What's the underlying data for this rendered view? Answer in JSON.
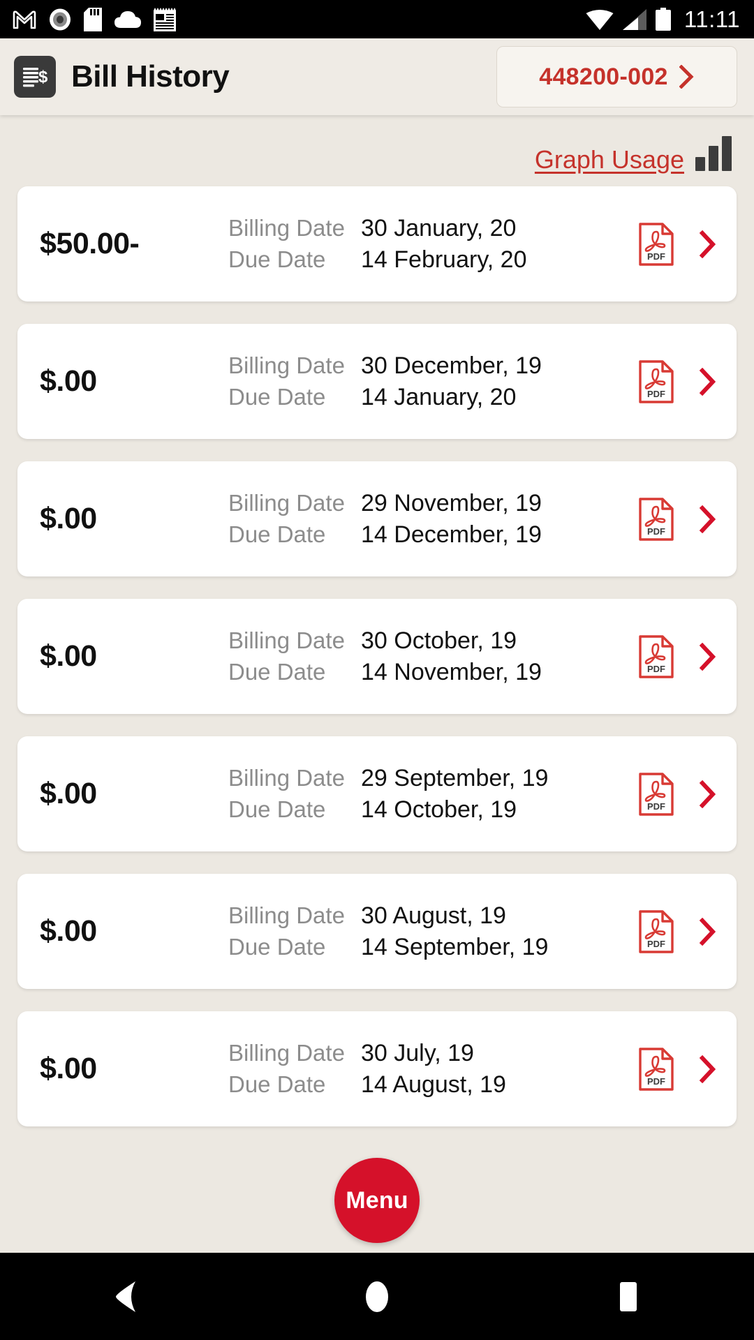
{
  "status_bar": {
    "time": "11:11",
    "left_icons": [
      "gmail-icon",
      "record-circle-icon",
      "sd-card-icon",
      "cloud-icon",
      "news-notepad-icon"
    ],
    "right_icons": [
      "wifi-icon",
      "cellular-signal-icon",
      "battery-icon"
    ]
  },
  "header": {
    "icon": "bill-dollar-icon",
    "title": "Bill History",
    "account": {
      "number": "448200-002",
      "chevron": "chevron-right-icon"
    }
  },
  "graph_usage": {
    "label": "Graph Usage",
    "icon": "bar-chart-icon"
  },
  "labels": {
    "billing_date": "Billing Date",
    "due_date": "Due Date",
    "pdf": "PDF"
  },
  "bills": [
    {
      "amount": "$50.00-",
      "billing_date": "30 January, 20",
      "due_date": "14 February, 20"
    },
    {
      "amount": "$.00",
      "billing_date": "30 December, 19",
      "due_date": "14 January, 20"
    },
    {
      "amount": "$.00",
      "billing_date": "29 November, 19",
      "due_date": "14 December, 19"
    },
    {
      "amount": "$.00",
      "billing_date": "30 October, 19",
      "due_date": "14 November, 19"
    },
    {
      "amount": "$.00",
      "billing_date": "29 September, 19",
      "due_date": "14 October, 19"
    },
    {
      "amount": "$.00",
      "billing_date": "30 August, 19",
      "due_date": "14 September, 19"
    },
    {
      "amount": "$.00",
      "billing_date": "30 July, 19",
      "due_date": "14 August, 19"
    }
  ],
  "fab": {
    "label": "Menu"
  },
  "nav_bar": {
    "back": "back-triangle-icon",
    "home": "home-circle-icon",
    "recents": "recents-square-icon"
  },
  "colors": {
    "accent_red": "#C5322B",
    "fab_red": "#D5112A",
    "page_bg": "#ECE8E1",
    "card_bg": "#FFFFFF",
    "label_gray": "#8C8C8C"
  }
}
